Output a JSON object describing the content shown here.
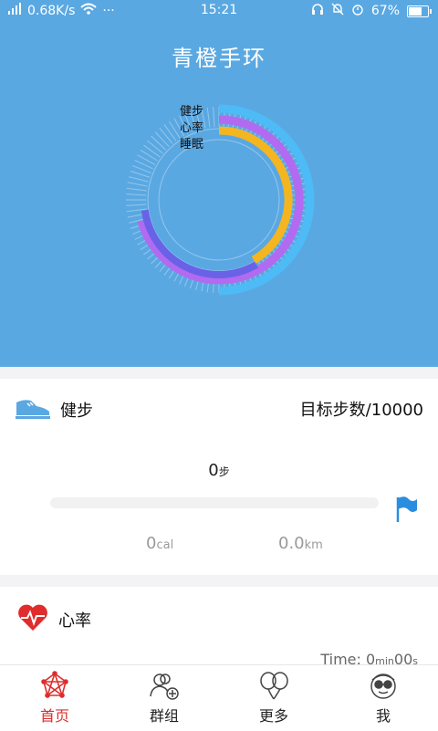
{
  "status_bar": {
    "network_speed": "0.68K/s",
    "dots": "···",
    "time": "15:21",
    "battery_percent": "67%"
  },
  "header": {
    "title": "青橙手环"
  },
  "rings": {
    "labels": [
      "健步",
      "心率",
      "睡眠"
    ],
    "colors": {
      "steps": "#4dbbf5",
      "heart": "#b26af0",
      "sleep": "#f5b520",
      "inner": "#6a62e6"
    }
  },
  "steps_card": {
    "title": "健步",
    "goal": "目标步数/10000",
    "steps_value": "0",
    "steps_unit": "步",
    "progress": 0,
    "calories_value": "0",
    "calories_unit": "cal",
    "distance_value": "0.0",
    "distance_unit": "km"
  },
  "heart_card": {
    "title": "心率",
    "time_prefix": "Time: 0",
    "time_min_unit": "min",
    "time_sec": "00",
    "time_sec_unit": "s"
  },
  "tabs": [
    {
      "label": "首页",
      "icon": "network-icon",
      "active": true
    },
    {
      "label": "群组",
      "icon": "add-user-icon",
      "active": false
    },
    {
      "label": "更多",
      "icon": "balloons-icon",
      "active": false
    },
    {
      "label": "我",
      "icon": "profile-face-icon",
      "active": false
    }
  ],
  "colors": {
    "accent": "#5aa8e2",
    "active_tab": "#e02c2c",
    "heart_red": "#e02c2c"
  }
}
